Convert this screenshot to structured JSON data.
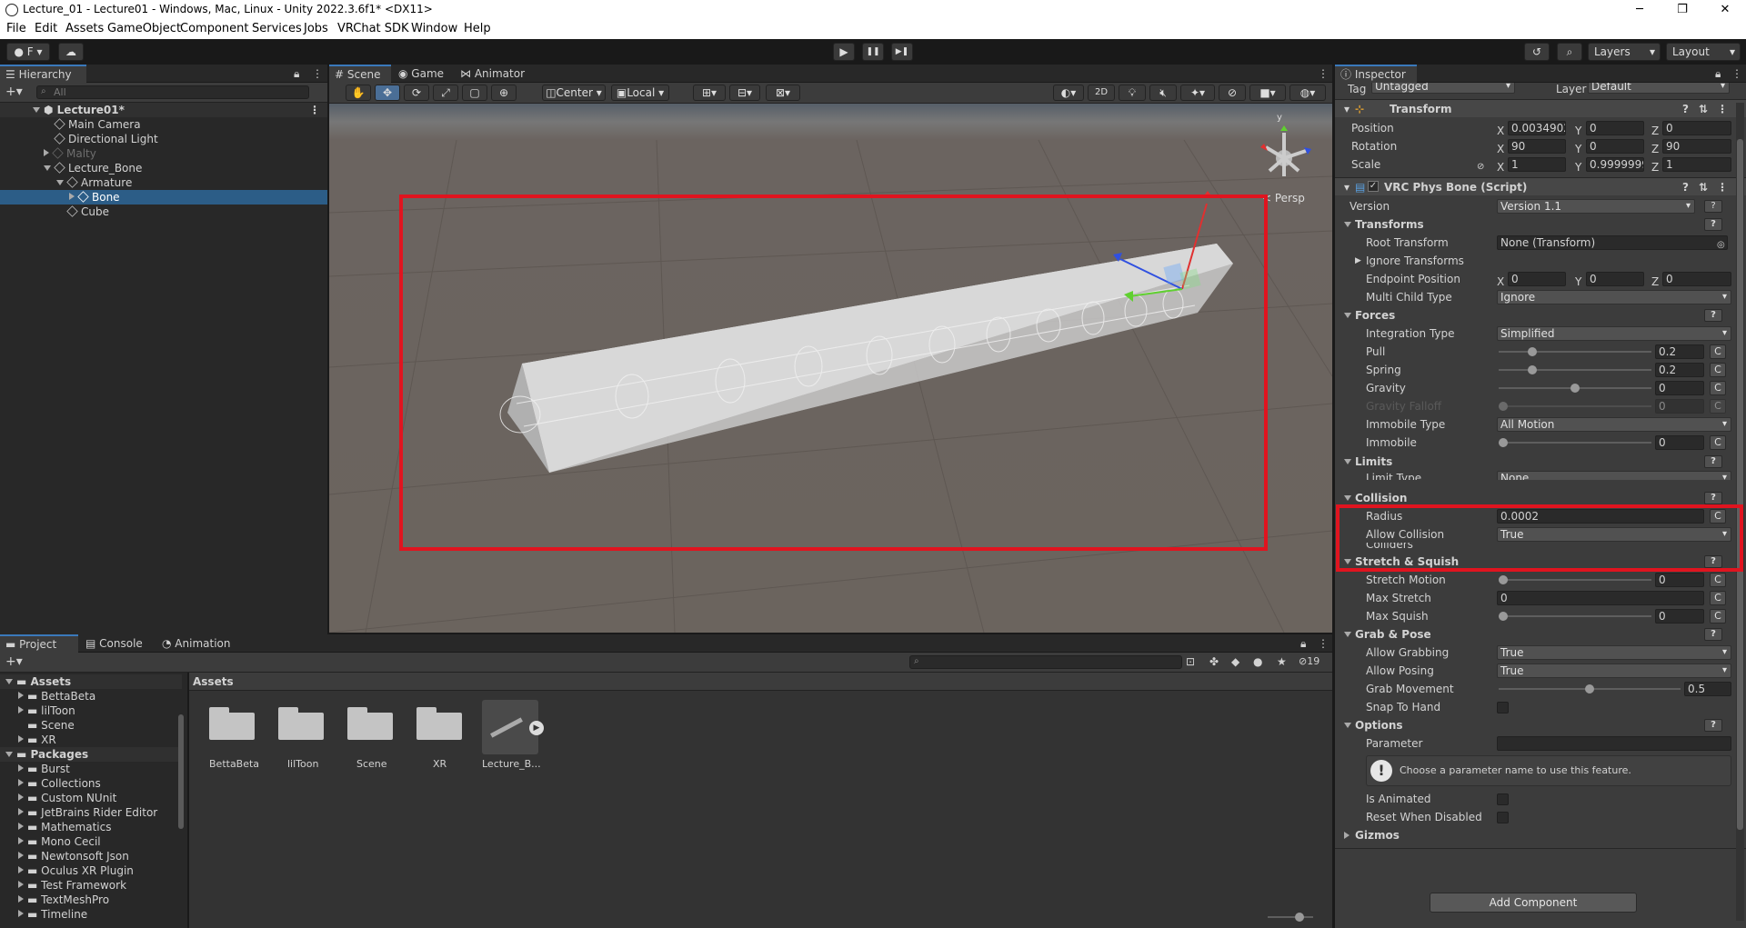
{
  "window": {
    "title": "Lecture_01 - Lecture01 - Windows, Mac, Linux - Unity 2022.3.6f1* <DX11>",
    "minimize": "─",
    "maximize": "❐",
    "close": "✕"
  },
  "menu": [
    "File",
    "Edit",
    "Assets",
    "GameObject",
    "Component",
    "Services",
    "Jobs",
    "VRChat SDK",
    "Window",
    "Help"
  ],
  "toolbar": {
    "account_label": "F",
    "play": "▶",
    "pause": "❚❚",
    "step": "▶❚",
    "layers_label": "Layers",
    "layout_label": "Layout"
  },
  "hierarchy": {
    "tab_label": "Hierarchy",
    "search_placeholder": "All",
    "items": [
      {
        "label": "Lecture01*",
        "depth": 0,
        "type": "scene",
        "expanded": true
      },
      {
        "label": "Main Camera",
        "depth": 1,
        "type": "object"
      },
      {
        "label": "Directional Light",
        "depth": 1,
        "type": "object"
      },
      {
        "label": "Malty",
        "depth": 1,
        "type": "object",
        "disabled": true,
        "collapsed": true
      },
      {
        "label": "Lecture_Bone",
        "depth": 1,
        "type": "object",
        "expanded": true
      },
      {
        "label": "Armature",
        "depth": 2,
        "type": "object",
        "expanded": true
      },
      {
        "label": "Bone",
        "depth": 3,
        "type": "object",
        "selected": true,
        "collapsed": true
      },
      {
        "label": "Cube",
        "depth": 2,
        "type": "object"
      }
    ]
  },
  "scene_view": {
    "tabs": [
      "Scene",
      "Game",
      "Animator"
    ],
    "active_tab": "Scene",
    "pivot_label": "Center",
    "space_label": "Local",
    "mode_2d": "2D",
    "persp_label": "< Persp",
    "gizmo_y": "y"
  },
  "project": {
    "tabs": [
      "Project",
      "Console",
      "Animation"
    ],
    "active_tab": "Project",
    "hidden_count": "19",
    "tree": [
      {
        "label": "Assets",
        "depth": 0,
        "bold": true,
        "expanded": true
      },
      {
        "label": "BettaBeta",
        "depth": 1
      },
      {
        "label": "lilToon",
        "depth": 1
      },
      {
        "label": "Scene",
        "depth": 1
      },
      {
        "label": "XR",
        "depth": 1
      },
      {
        "label": "Packages",
        "depth": 0,
        "bold": true,
        "expanded": true
      },
      {
        "label": "Burst",
        "depth": 1
      },
      {
        "label": "Collections",
        "depth": 1
      },
      {
        "label": "Custom NUnit",
        "depth": 1
      },
      {
        "label": "JetBrains Rider Editor",
        "depth": 1
      },
      {
        "label": "Mathematics",
        "depth": 1
      },
      {
        "label": "Mono Cecil",
        "depth": 1
      },
      {
        "label": "Newtonsoft Json",
        "depth": 1
      },
      {
        "label": "Oculus XR Plugin",
        "depth": 1
      },
      {
        "label": "Test Framework",
        "depth": 1
      },
      {
        "label": "TextMeshPro",
        "depth": 1
      },
      {
        "label": "Timeline",
        "depth": 1
      }
    ],
    "breadcrumb": "Assets",
    "items": [
      {
        "label": "BettaBeta",
        "type": "folder"
      },
      {
        "label": "lilToon",
        "type": "folder"
      },
      {
        "label": "Scene",
        "type": "folder"
      },
      {
        "label": "XR",
        "type": "folder"
      },
      {
        "label": "Lecture_B...",
        "type": "model"
      }
    ]
  },
  "inspector": {
    "tab_label": "Inspector",
    "tag_label": "Tag",
    "tag_value": "Untagged",
    "layer_label": "Layer",
    "layer_value": "Default",
    "transform": {
      "title": "Transform",
      "position": {
        "label": "Position",
        "x": "0.0034902",
        "y": "0",
        "z": "0"
      },
      "rotation": {
        "label": "Rotation",
        "x": "90",
        "y": "0",
        "z": "90"
      },
      "scale": {
        "label": "Scale",
        "x": "1",
        "y": "0.9999999",
        "z": "1"
      }
    },
    "physbone": {
      "title": "VRC Phys Bone (Script)",
      "version": {
        "label": "Version",
        "value": "Version 1.1"
      },
      "transforms": {
        "header": "Transforms",
        "root_transform": {
          "label": "Root Transform",
          "value": "None (Transform)"
        },
        "ignore_transforms": "Ignore Transforms",
        "endpoint": {
          "label": "Endpoint Position",
          "x": "0",
          "y": "0",
          "z": "0"
        },
        "multi_child": {
          "label": "Multi Child Type",
          "value": "Ignore"
        }
      },
      "forces": {
        "header": "Forces",
        "integration": {
          "label": "Integration Type",
          "value": "Simplified"
        },
        "pull": {
          "label": "Pull",
          "value": "0.2",
          "ratio": 0.2
        },
        "spring": {
          "label": "Spring",
          "value": "0.2",
          "ratio": 0.2
        },
        "gravity": {
          "label": "Gravity",
          "value": "0",
          "ratio": 0.5
        },
        "gravity_falloff": {
          "label": "Gravity Falloff",
          "value": "0",
          "ratio": 0.0
        },
        "immobile_type": {
          "label": "Immobile Type",
          "value": "All Motion"
        },
        "immobile": {
          "label": "Immobile",
          "value": "0",
          "ratio": 0.0
        }
      },
      "limits": {
        "header": "Limits",
        "limit_type": {
          "label": "Limit Type",
          "value": "None"
        }
      },
      "collision": {
        "header": "Collision",
        "radius": {
          "label": "Radius",
          "value": "0.0002"
        },
        "allow_collision": {
          "label": "Allow Collision",
          "value": "True"
        },
        "colliders": "Colliders"
      },
      "stretch": {
        "header": "Stretch & Squish",
        "stretch_motion": {
          "label": "Stretch Motion",
          "value": "0",
          "ratio": 0.0
        },
        "max_stretch": {
          "label": "Max Stretch",
          "value": "0"
        },
        "max_squish": {
          "label": "Max Squish",
          "value": "0",
          "ratio": 0.0
        }
      },
      "grab": {
        "header": "Grab & Pose",
        "allow_grabbing": {
          "label": "Allow Grabbing",
          "value": "True"
        },
        "allow_posing": {
          "label": "Allow Posing",
          "value": "True"
        },
        "grab_movement": {
          "label": "Grab Movement",
          "value": "0.5",
          "ratio": 0.5
        },
        "snap_to_hand": {
          "label": "Snap To Hand"
        }
      },
      "options": {
        "header": "Options",
        "parameter": {
          "label": "Parameter",
          "value": ""
        },
        "help_text": "Choose a parameter name to use this feature.",
        "is_animated": "Is Animated",
        "reset_disabled": "Reset When Disabled"
      },
      "gizmos": "Gizmos"
    },
    "add_component": "Add Component",
    "c_label": "C",
    "q_label": "?"
  },
  "colors": {
    "accent": "#2c5d87",
    "highlight": "#e0141f",
    "tab_active": "#3a79bb"
  }
}
